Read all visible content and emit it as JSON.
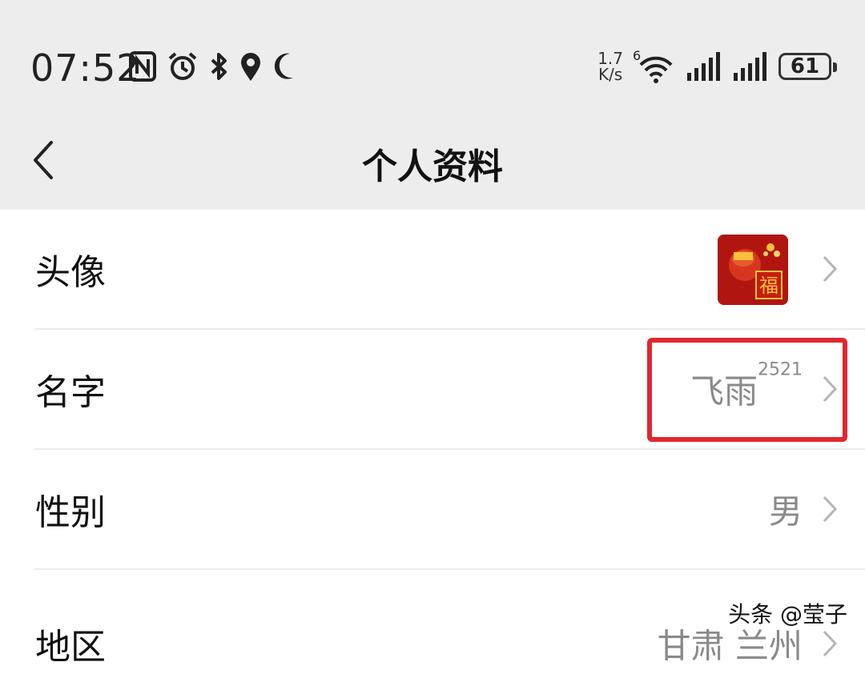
{
  "status": {
    "time": "07:52",
    "speed_value": "1.7",
    "speed_unit": "K/s",
    "wifi_label": "6",
    "battery": "61"
  },
  "header": {
    "title": "个人资料"
  },
  "rows": [
    {
      "label": "头像",
      "value": ""
    },
    {
      "label": "名字",
      "value": "飞雨",
      "sup": "2521"
    },
    {
      "label": "性别",
      "value": "男"
    },
    {
      "label": "地区",
      "value": "甘肃 兰州"
    }
  ],
  "avatar": {
    "text": "福",
    "colors": {
      "bg": "#b0160f",
      "accent": "#f3c23a"
    }
  },
  "watermark": {
    "text": "头条 @莹子"
  },
  "colors": {
    "highlight_border": "#e2262f",
    "header_bg": "#ededed"
  }
}
